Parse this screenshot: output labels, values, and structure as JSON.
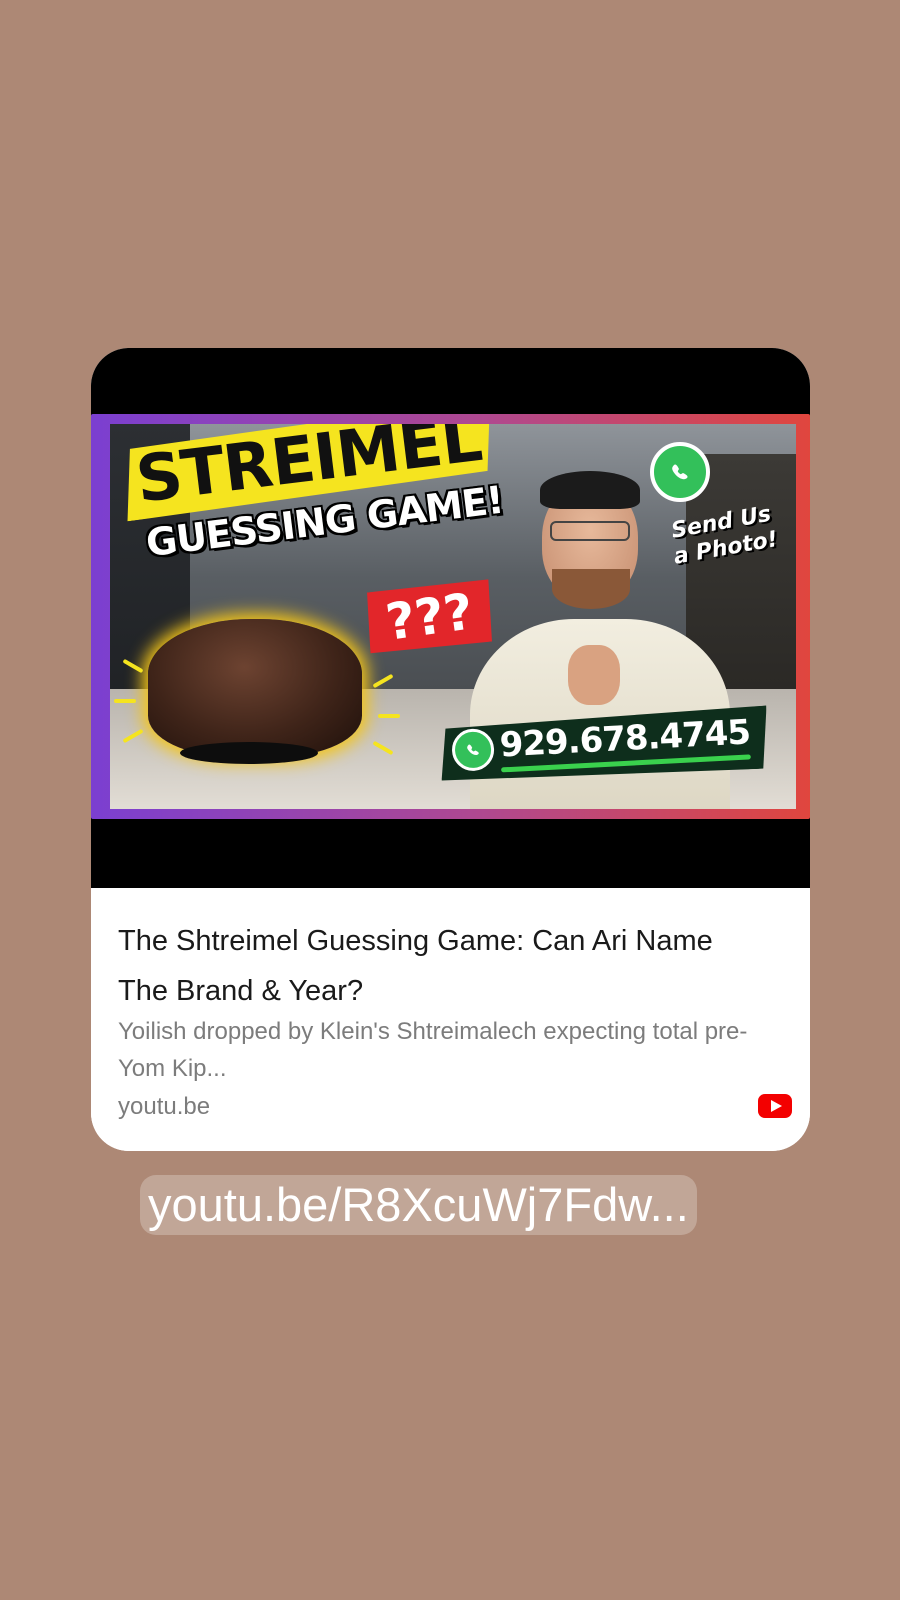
{
  "thumbnail": {
    "headline_line1": "STREIMEL",
    "headline_line2": "GUESSING GAME!",
    "question_marks": "???",
    "send_photo_line1": "Send Us",
    "send_photo_line2": "a Photo!",
    "phone": "929.678.4745"
  },
  "card": {
    "title": "The Shtreimel Guessing Game: Can Ari Name The Brand & Year?",
    "description": "Yoilish dropped by Klein's Shtreimalech expecting total pre-Yom Kip...",
    "domain": "youtu.be",
    "source_icon": "youtube-icon"
  },
  "link_text": "youtu.be/R8XcuWj7Fdw...",
  "colors": {
    "background": "#ad8875",
    "headline_yellow": "#f5e41f",
    "qmark_red": "#e2262a",
    "whatsapp_green": "#33c05a",
    "youtube_red": "#f30000"
  }
}
